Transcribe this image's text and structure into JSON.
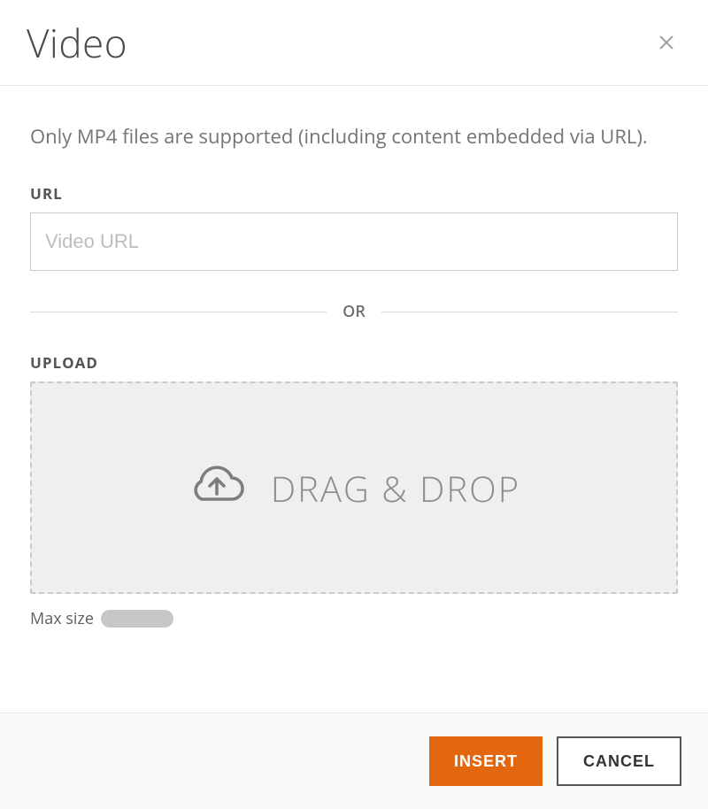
{
  "modal": {
    "title": "Video",
    "description": "Only MP4 files are supported (including content embedded via URL).",
    "url_section": {
      "label": "URL",
      "placeholder": "Video URL",
      "value": ""
    },
    "separator_label": "OR",
    "upload_section": {
      "label": "UPLOAD",
      "dropzone_text": "DRAG & DROP",
      "max_size_label": "Max size"
    },
    "footer": {
      "insert_label": "INSERT",
      "cancel_label": "CANCEL"
    },
    "icons": {
      "close": "close-icon",
      "cloud_upload": "cloud-upload-icon"
    }
  }
}
